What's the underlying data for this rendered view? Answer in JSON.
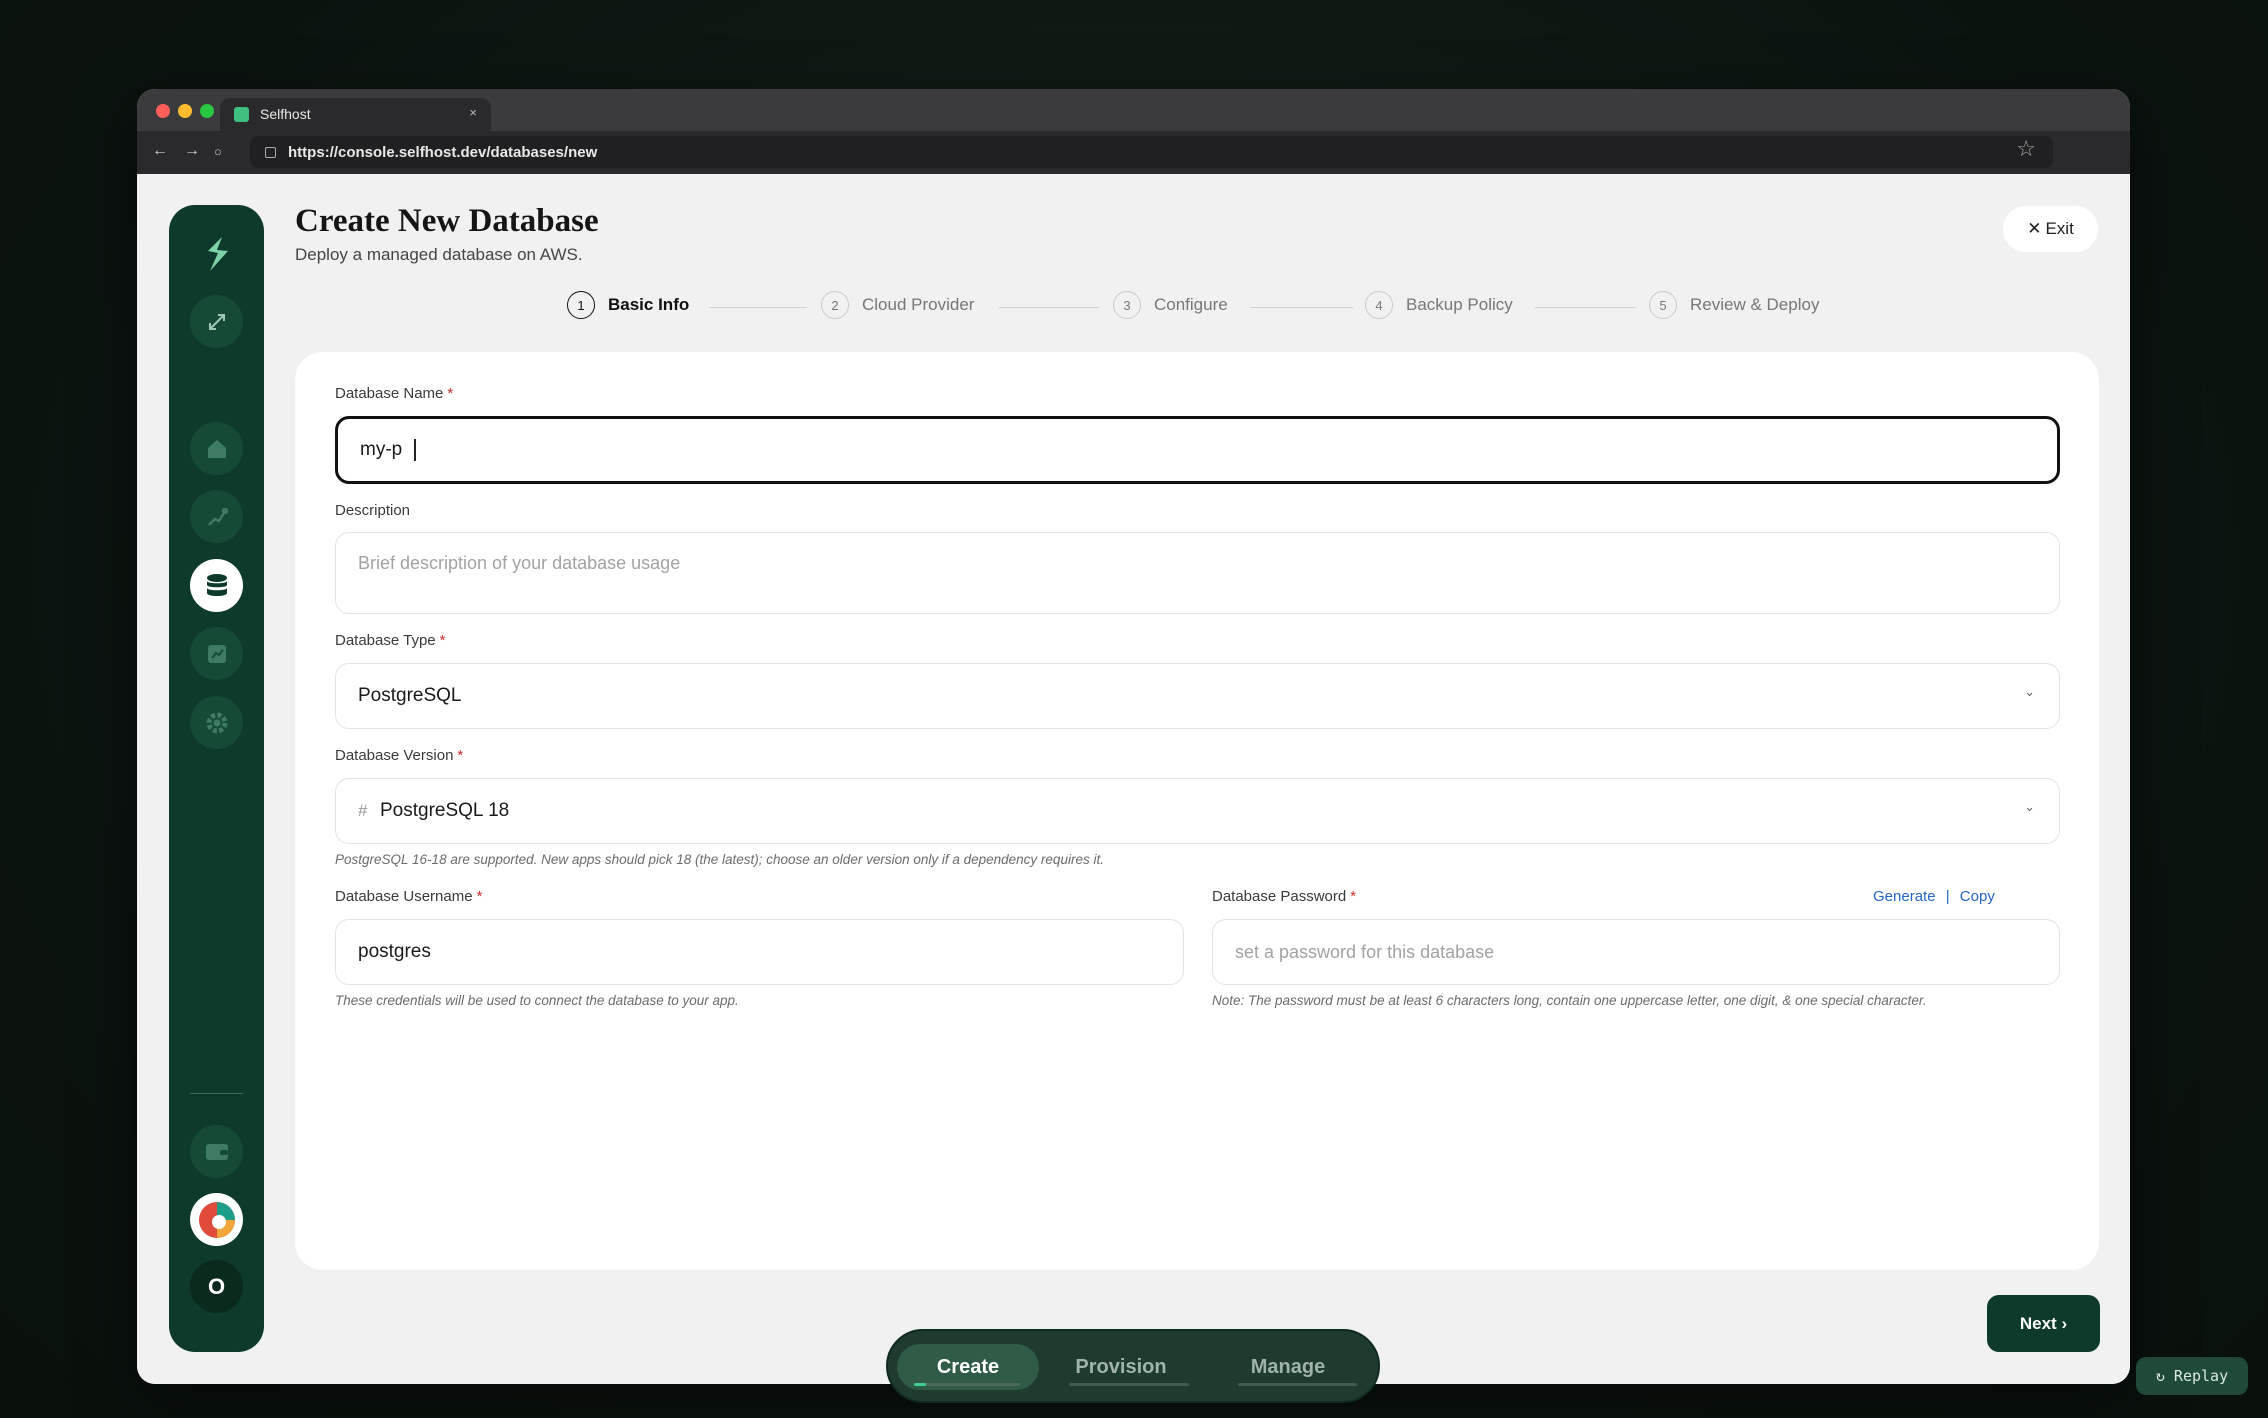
{
  "browser": {
    "tab_title": "Selfhost",
    "tab_close": "×",
    "url": "https://console.selfhost.dev/databases/new",
    "back": "←",
    "forward": "→",
    "reload": "○"
  },
  "header": {
    "title": "Create New Database",
    "subtitle": "Deploy a managed database on AWS.",
    "exit_label": "Exit"
  },
  "steps": [
    {
      "num": "1",
      "label": "Basic Info",
      "active": true
    },
    {
      "num": "2",
      "label": "Cloud Provider",
      "active": false
    },
    {
      "num": "3",
      "label": "Configure",
      "active": false
    },
    {
      "num": "4",
      "label": "Backup Policy",
      "active": false
    },
    {
      "num": "5",
      "label": "Review & Deploy",
      "active": false
    }
  ],
  "form": {
    "name": {
      "label": "Database Name",
      "required": "*",
      "value": "my-p"
    },
    "description": {
      "label": "Description",
      "placeholder": "Brief description of your database usage"
    },
    "type": {
      "label": "Database Type",
      "required": "*",
      "value": "PostgreSQL",
      "chevron": "⌄"
    },
    "version": {
      "label": "Database Version",
      "required": "*",
      "prefix": "#",
      "value": "PostgreSQL 18",
      "chevron": "⌄",
      "hint": "PostgreSQL 16-18 are supported. New apps should pick 18 (the latest); choose an older version only if a dependency requires it."
    },
    "username": {
      "label": "Database Username",
      "required": "*",
      "value": "postgres",
      "hint": "These credentials will be used to connect the database to your app."
    },
    "password": {
      "label": "Database Password",
      "required": "*",
      "placeholder": "set a password for this database",
      "generate": "Generate",
      "separator": "|",
      "copy": "Copy",
      "hint": "Note: The password must be at least 6 characters long, contain one uppercase letter, one digit, & one special character."
    }
  },
  "actions": {
    "next_label": "Next ›"
  },
  "bottom_nav": {
    "tabs": [
      "Create",
      "Provision",
      "Manage"
    ],
    "active": "Create"
  },
  "replay_label": "↻ Replay",
  "user_initial": "O",
  "colors": {
    "primary": "#0d3a2a",
    "link": "#2566c4",
    "required": "#d12c2c"
  }
}
